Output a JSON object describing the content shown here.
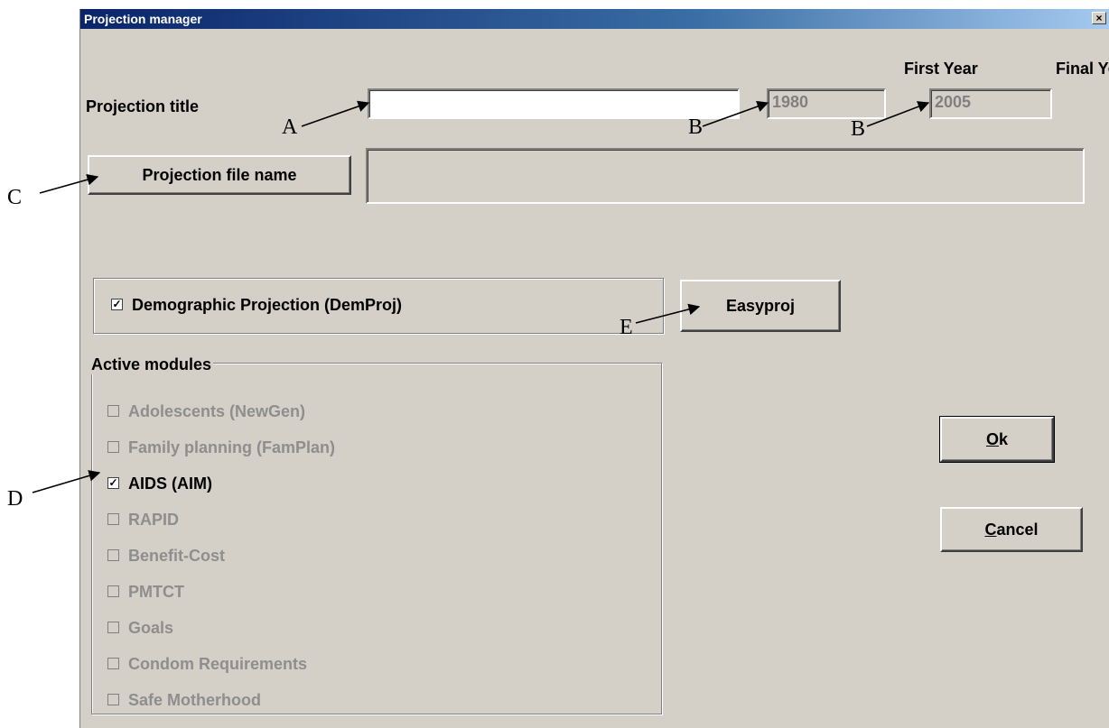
{
  "window": {
    "title": "Projection manager",
    "close_glyph": "×"
  },
  "labels": {
    "projection_title": "Projection title",
    "first_year": "First Year",
    "final_year": "Final Year"
  },
  "fields": {
    "projection_title_value": "",
    "first_year_value": "1980",
    "final_year_value": "2005",
    "file_name_value": ""
  },
  "buttons": {
    "projection_file_name": "Projection file name",
    "easyproj": "Easyproj",
    "ok": "Ok",
    "cancel": "Cancel"
  },
  "demproj": {
    "label": "Demographic Projection (DemProj)",
    "checked": true
  },
  "active_modules": {
    "title": "Active modules",
    "items": [
      {
        "label": "Adolescents (NewGen)",
        "checked": false,
        "enabled": false
      },
      {
        "label": "Family planning (FamPlan)",
        "checked": false,
        "enabled": false
      },
      {
        "label": "AIDS (AIM)",
        "checked": true,
        "enabled": true
      },
      {
        "label": "RAPID",
        "checked": false,
        "enabled": false
      },
      {
        "label": "Benefit-Cost",
        "checked": false,
        "enabled": false
      },
      {
        "label": "PMTCT",
        "checked": false,
        "enabled": false
      },
      {
        "label": "Goals",
        "checked": false,
        "enabled": false
      },
      {
        "label": "Condom Requirements",
        "checked": false,
        "enabled": false
      },
      {
        "label": "Safe Motherhood",
        "checked": false,
        "enabled": false
      }
    ]
  },
  "annotations": {
    "a": "A",
    "b1": "B",
    "b2": "B",
    "c": "C",
    "d": "D",
    "e": "E"
  }
}
